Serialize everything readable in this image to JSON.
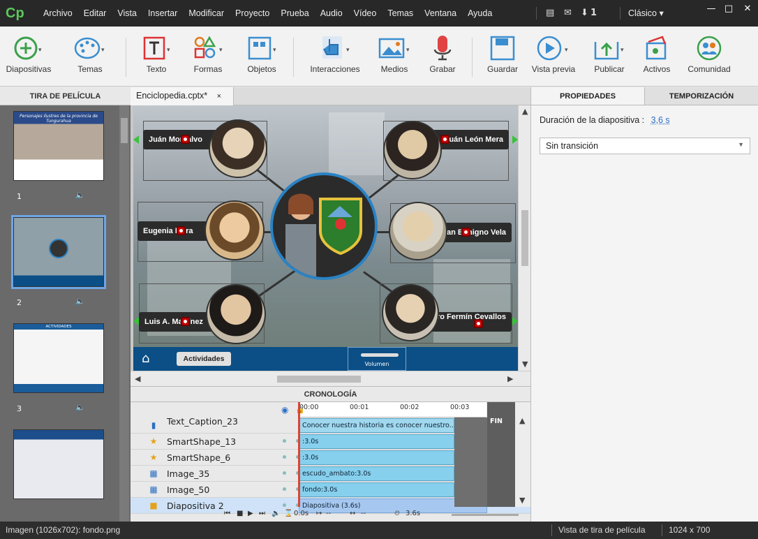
{
  "menubar": {
    "logo": "Cp",
    "menus": [
      "Archivo",
      "Editar",
      "Vista",
      "Insertar",
      "Modificar",
      "Proyecto",
      "Prueba",
      "Audio",
      "Vídeo",
      "Temas",
      "Ventana",
      "Ayuda"
    ],
    "notification_count": "1",
    "workspace": "Clásico"
  },
  "toolbar": {
    "diapositivas": "Diapositivas",
    "temas": "Temas",
    "texto": "Texto",
    "formas": "Formas",
    "objetos": "Objetos",
    "interacciones": "Interacciones",
    "medios": "Medios",
    "grabar": "Grabar",
    "guardar": "Guardar",
    "vista_previa": "Vista previa",
    "publicar": "Publicar",
    "activos": "Activos",
    "comunidad": "Comunidad"
  },
  "filmstrip": {
    "title": "TIRA DE PELÍCULA",
    "slides": [
      {
        "num": "1",
        "caption": "Personajes ilustres de la provincia de Tungurahua"
      },
      {
        "num": "2"
      },
      {
        "num": "3",
        "caption": "ACTIVIDADES"
      },
      {
        "num": ""
      }
    ]
  },
  "document": {
    "tab": "Enciclopedia.cptx*",
    "close": "×"
  },
  "stage": {
    "people": {
      "tl": "Juán Montalvo",
      "tr": "Juán León Mera",
      "ml": "Eugenia Mera",
      "mr": "Juan Benigno Vela",
      "bl": "Luis A. Martínez",
      "br": "Pedro Fermín Cevallos"
    },
    "actividades": "Actividades",
    "volumen": "Volumen"
  },
  "timeline": {
    "title": "CRONOLOGÍA",
    "ruler": [
      "00:00",
      "00:01",
      "00:02",
      "00:03"
    ],
    "fin": "FIN",
    "rows": [
      {
        "name": "Text_Caption_23",
        "bar": "Conocer nuestra historia es conocer nuestro..."
      },
      {
        "name": "SmartShape_13",
        "bar": ":3.0s"
      },
      {
        "name": "SmartShape_6",
        "bar": ":3.0s"
      },
      {
        "name": "Image_35",
        "bar": "escudo_ambato:3.0s"
      },
      {
        "name": "Image_50",
        "bar": "fondo:3.0s"
      },
      {
        "name": "Diapositiva 2",
        "bar": "Diapositiva (3.6s)"
      }
    ],
    "controls": {
      "start": "0.0s",
      "a": "--",
      "b": "--",
      "dur": "3.6s"
    }
  },
  "properties": {
    "tab_props": "PROPIEDADES",
    "tab_timing": "TEMPORIZACIÓN",
    "duration_label": "Duración de la diapositiva :",
    "duration_value": "3,6 s",
    "transition": "Sin transición"
  },
  "status": {
    "left": "Imagen (1026x702): fondo.png",
    "view": "Vista de tira de película",
    "size": "1024 x 700"
  }
}
